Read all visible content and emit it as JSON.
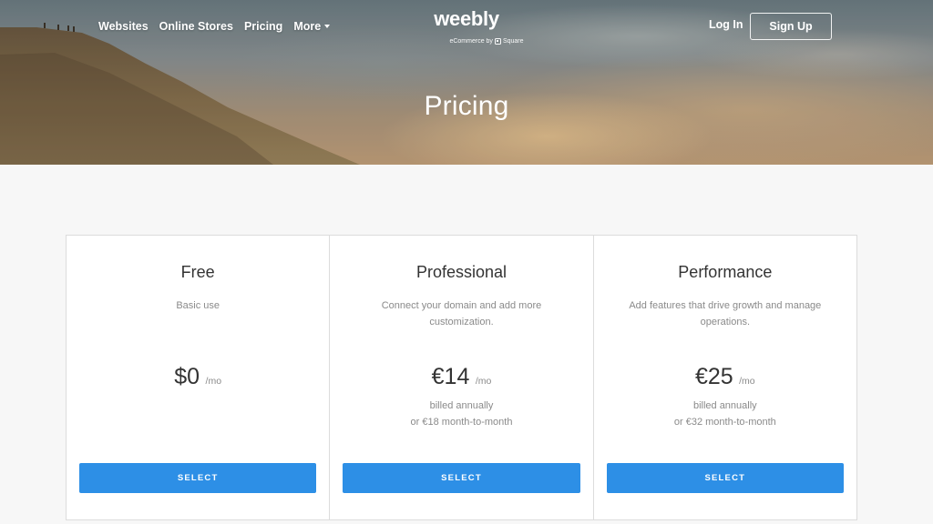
{
  "nav": {
    "links": [
      {
        "label": "Websites"
      },
      {
        "label": "Online Stores"
      },
      {
        "label": "Pricing"
      },
      {
        "label": "More"
      }
    ],
    "login_label": "Log In",
    "signup_label": "Sign Up"
  },
  "logo": {
    "word": "weebly",
    "sub_prefix": "eCommerce by",
    "sub_brand": "Square"
  },
  "hero": {
    "title": "Pricing"
  },
  "plans": [
    {
      "name": "Free",
      "description": "Basic use",
      "price": "$0",
      "per": "/mo",
      "billing_line1": "",
      "billing_line2": "",
      "button": "SELECT"
    },
    {
      "name": "Professional",
      "description": "Connect your domain and add more customization.",
      "price": "€14",
      "per": "/mo",
      "billing_line1": "billed annually",
      "billing_line2": "or €18 month-to-month",
      "button": "SELECT"
    },
    {
      "name": "Performance",
      "description": "Add features that drive growth and manage operations.",
      "price": "€25",
      "per": "/mo",
      "billing_line1": "billed annually",
      "billing_line2": "or €32 month-to-month",
      "button": "SELECT"
    }
  ],
  "colors": {
    "accent": "#2d8fe6",
    "page_bg": "#f7f7f7",
    "card_border": "#dcdcdc"
  }
}
